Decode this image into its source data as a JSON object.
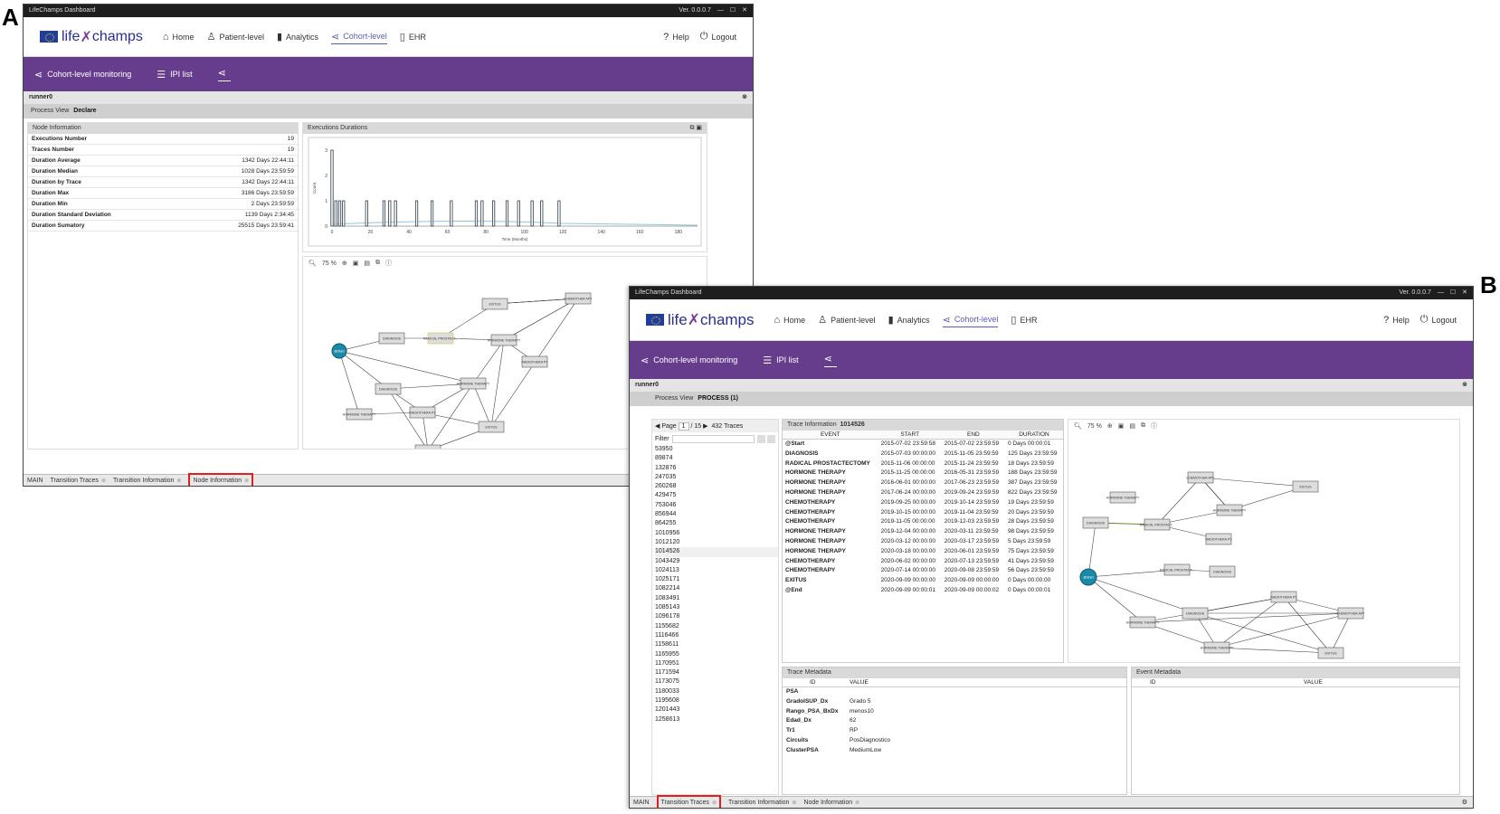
{
  "labels": {
    "a": "A",
    "b": "B"
  },
  "app": {
    "title": "LifeChamps Dashboard",
    "version": "Ver. 0.0.0.7",
    "logo_life": "life",
    "logo_champs": "champs",
    "nav": [
      {
        "label": "Home",
        "icon": "home-icon"
      },
      {
        "label": "Patient-level",
        "icon": "user-icon"
      },
      {
        "label": "Analytics",
        "icon": "bar-chart-icon"
      },
      {
        "label": "Cohort-level",
        "icon": "share-icon"
      },
      {
        "label": "EHR",
        "icon": "document-icon"
      }
    ],
    "help": "Help",
    "logout": "Logout",
    "sub_monitoring": "Cohort-level monitoring",
    "sub_ipi": "IPI list",
    "runner": "runner0",
    "process_view_label": "Process View"
  },
  "winA": {
    "process_value": "Declare",
    "node_info_header": "Node Information",
    "exec_header": "Executions Durations",
    "node_info": [
      {
        "k": "Executions Number",
        "v": "19"
      },
      {
        "k": "Traces Number",
        "v": "19"
      },
      {
        "k": "Duration Average",
        "v": "1342 Days 22:44:11"
      },
      {
        "k": "Duration Median",
        "v": "1028 Days 23:59:59"
      },
      {
        "k": "Duration by Trace",
        "v": "1342 Days 22:44:11"
      },
      {
        "k": "Duration Max",
        "v": "3186 Days 23:59:59"
      },
      {
        "k": "Duration Min",
        "v": "2 Days 23:59:59"
      },
      {
        "k": "Duration Standard Deviation",
        "v": "1139 Days 2:34:45"
      },
      {
        "k": "Duration Sumatory",
        "v": "25515 Days 23:59:41"
      }
    ],
    "zoom": "75 %",
    "tabs": [
      "MAIN",
      "Transition Traces",
      "Transition Information",
      "Node Information"
    ]
  },
  "chart_data": {
    "type": "bar",
    "title": "",
    "xlabel": "Time (Months)",
    "ylabel": "Count",
    "xlim": [
      0,
      190
    ],
    "ylim": [
      0,
      3
    ],
    "xticks": [
      0,
      20,
      40,
      60,
      80,
      100,
      120,
      140,
      160,
      180
    ],
    "yticks": [
      0,
      1,
      2,
      3
    ],
    "x": [
      0,
      2,
      4,
      6,
      18,
      27,
      30,
      33,
      44,
      52,
      62,
      75,
      78,
      84,
      91,
      97,
      104,
      109,
      118
    ],
    "values": [
      3,
      1,
      1,
      1,
      1,
      1,
      1,
      1,
      1,
      1,
      1,
      1,
      1,
      1,
      1,
      1,
      1,
      1,
      1
    ]
  },
  "winB": {
    "process_value": "PROCESS (1)",
    "page_label": "Page",
    "page_current": "1",
    "page_total": "/ 15",
    "traces_count": "432",
    "traces_label": "Traces",
    "filter_label": "Filter",
    "trace_ids": [
      "53950",
      "89874",
      "132876",
      "247035",
      "260268",
      "429475",
      "753046",
      "856944",
      "864255",
      "1010956",
      "1012120",
      "1014526",
      "1043429",
      "1024113",
      "1025171",
      "1082214",
      "1083491",
      "1085143",
      "1096178",
      "1155682",
      "1116466",
      "1158611",
      "1165955",
      "1170951",
      "1171594",
      "1173075",
      "1180033",
      "1195608",
      "1201443",
      "1258613"
    ],
    "trace_info_label": "Trace Information",
    "trace_id": "1014526",
    "ev_cols": [
      "EVENT",
      "START",
      "END",
      "DURATION"
    ],
    "events": [
      [
        "@Start",
        "2015-07-02 23:59:58",
        "2015-07-02 23:59:59",
        "0 Days 00:00:01"
      ],
      [
        "DIAGNOSIS",
        "2015-07-03 00:00:00",
        "2015-11-05 23:59:59",
        "125 Days 23:59:59"
      ],
      [
        "RADICAL PROSTACTECTOMY",
        "2015-11-06 00:00:00",
        "2015-11-24 23:59:59",
        "18 Days 23:59:59"
      ],
      [
        "HORMONE THERAPY",
        "2015-11-25 00:00:00",
        "2016-05-31 23:59:59",
        "188 Days 23:59:59"
      ],
      [
        "HORMONE THERAPY",
        "2016-06-01 00:00:00",
        "2017-06-23 23:59:59",
        "387 Days 23:59:59"
      ],
      [
        "HORMONE THERAPY",
        "2017-06-24 00:00:00",
        "2019-09-24 23:59:59",
        "822 Days 23:59:59"
      ],
      [
        "CHEMOTHERAPY",
        "2019-09-25 00:00:00",
        "2019-10-14 23:59:59",
        "19 Days 23:59:59"
      ],
      [
        "CHEMOTHERAPY",
        "2019-10-15 00:00:00",
        "2019-11-04 23:59:59",
        "20 Days 23:59:59"
      ],
      [
        "CHEMOTHERAPY",
        "2019-11-05 00:00:00",
        "2019-12-03 23:59:59",
        "28 Days 23:59:59"
      ],
      [
        "HORMONE THERAPY",
        "2019-12-04 00:00:00",
        "2020-03-11 23:59:59",
        "98 Days 23:59:59"
      ],
      [
        "HORMONE THERAPY",
        "2020-03-12 00:00:00",
        "2020-03-17 23:59:59",
        "5 Days 23:59:59"
      ],
      [
        "HORMONE THERAPY",
        "2020-03-18 00:00:00",
        "2020-06-01 23:59:59",
        "75 Days 23:59:59"
      ],
      [
        "CHEMOTHERAPY",
        "2020-06-02 00:00:00",
        "2020-07-13 23:59:59",
        "41 Days 23:59:59"
      ],
      [
        "CHEMOTHERAPY",
        "2020-07-14 00:00:00",
        "2020-09-08 23:59:59",
        "56 Days 23:59:59"
      ],
      [
        "EXITUS",
        "2020-09-09 00:00:00",
        "2020-09-09 00:00:00",
        "0 Days 00:00:00"
      ],
      [
        "@End",
        "2020-09-09 00:00:01",
        "2020-09-09 00:00:02",
        "0 Days 00:00:01"
      ]
    ],
    "zoom": "75 %",
    "trace_meta_label": "Trace Metadata",
    "event_meta_label": "Event Metadata",
    "meta_cols": [
      "ID",
      "VALUE"
    ],
    "trace_meta": [
      [
        "PSA",
        ""
      ],
      [
        "GradoISUP_Dx",
        "Grado 5"
      ],
      [
        "Rango_PSA_BxDx",
        "menos10"
      ],
      [
        "Edad_Dx",
        "62"
      ],
      [
        "Tr1",
        "RP"
      ],
      [
        "Circuits",
        "PosDiagnostico"
      ],
      [
        "ClusterPSA",
        "MediumLow"
      ]
    ],
    "tabs": [
      "MAIN",
      "Transition Traces",
      "Transition Information",
      "Node Information"
    ]
  },
  "graphA_nodes": [
    "@Start",
    "DIAGNOSIS",
    "RADICAL PROSTACT...",
    "EXITUS",
    "CHEMOTHER APY",
    "HORMONE THERAPY",
    "RADIOTHERA PY",
    "DIAGNOSIS",
    "HORMONE THERAPY",
    "RADIOTHERA PY",
    "HORMONE THERAPY",
    "EXITUS",
    "CHEMOTHER APY"
  ],
  "graphB_nodes": [
    "@Start",
    "DIAGNOSIS",
    "HORMONE THERAPY",
    "RADICAL PROSTACT...",
    "CHEMOTHER APY",
    "HORMONE THERAPY",
    "EXITUS",
    "RADIOTHERA PY",
    "RADICAL PROSTACT...",
    "DIAGNOSIS",
    "HORMONE THERAPY",
    "DIAGNOSIS",
    "RADIOTHERA PY",
    "CHEMOTHER APY",
    "HORMONE THERAPY",
    "EXITUS"
  ]
}
